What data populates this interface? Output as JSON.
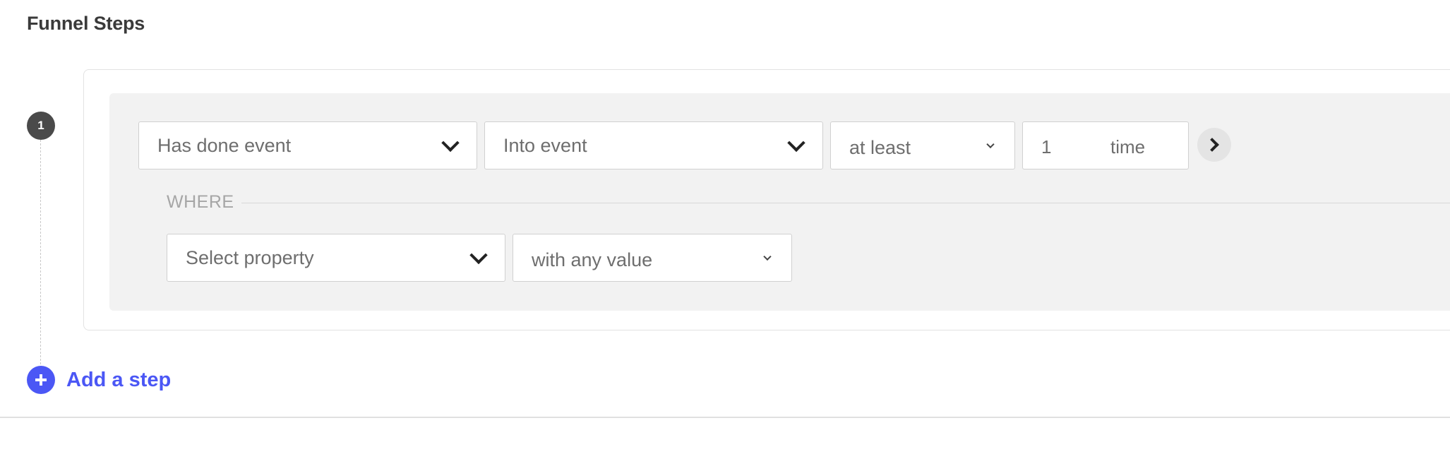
{
  "section": {
    "title": "Funnel Steps"
  },
  "steps": [
    {
      "number": "1",
      "event_condition": "Has done event",
      "event_name": "Into event",
      "frequency_operator": "at least",
      "frequency_count": "1",
      "frequency_unit": "time",
      "where_label": "WHERE",
      "property": "Select property",
      "property_operator": "with any value"
    }
  ],
  "add_step": {
    "label": "Add a step"
  },
  "colors": {
    "accent": "#4b57f5",
    "badge": "#4a4a4a",
    "panel": "#f2f2f2"
  },
  "icons": {
    "dropdown": "chevron-down-icon",
    "next": "chevron-right-icon",
    "add": "plus-circle-icon"
  }
}
